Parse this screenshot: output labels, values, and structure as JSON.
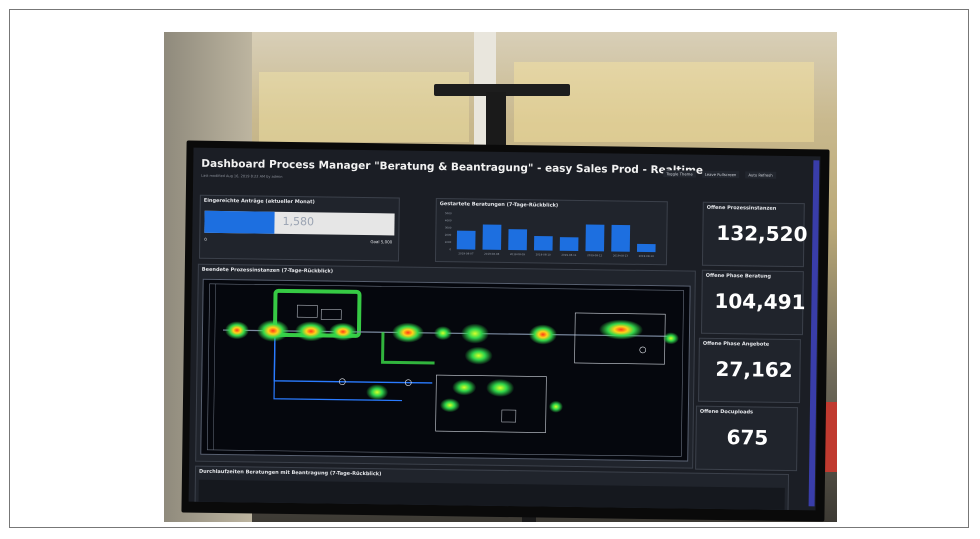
{
  "dashboard": {
    "title": "Dashboard Process Manager \"Beratung & Beantragung\" - easy Sales Prod - Realtime",
    "subtitle": "Last modified Aug 16, 2019 8:22 AM by admin",
    "controls": {
      "toggle_theme": "Toggle Theme",
      "leave_fullscreen": "Leave Fullscreen",
      "auto_refresh": "Auto Refresh"
    }
  },
  "eingereichte": {
    "title": "Eingereichte Anträge (aktueller Monat)",
    "value": "1,580",
    "min": "0",
    "goal": "Goal 5,000",
    "fill_fraction": 0.37
  },
  "gestartete": {
    "title": "Gestartete Beratungen (7-Tage-Rückblick)"
  },
  "stats": {
    "offene_prozess": {
      "label": "Offene Prozessinstanzen",
      "value": "132,520"
    },
    "offene_beratung": {
      "label": "Offene Phase Beratung",
      "value": "104,491"
    },
    "offene_angebote": {
      "label": "Offene Phase Angebote",
      "value": "27,162"
    },
    "offene_docuploads": {
      "label": "Offene Docuploads",
      "value": "675"
    }
  },
  "beendete": {
    "title": "Beendete Prozessinstanzen (7-Tage-Rückblick)"
  },
  "durchlauf": {
    "title": "Durchlaufzeiten Beratungen mit Beantragung (7-Tage-Rückblick)"
  },
  "chart_data": {
    "type": "bar",
    "title": "Gestartete Beratungen (7-Tage-Rückblick)",
    "categories": [
      "2019-08-07",
      "2019-08-08",
      "2019-08-09",
      "2019-08-10",
      "2019-08-11",
      "2019-08-12",
      "2019-08-13",
      "2019-08-14"
    ],
    "values": [
      2600,
      3500,
      2900,
      2000,
      1900,
      3700,
      3700,
      1100
    ],
    "ylim": [
      0,
      5000
    ],
    "yticks": [
      "0",
      "1000",
      "2000",
      "3000",
      "4000",
      "5000"
    ],
    "bar_color": "#1d6fe0"
  },
  "colors": {
    "screen_bg": "#1b1e25",
    "panel_bg": "#20242c",
    "accent_blue": "#1d6fe0",
    "heat_green": "#22d04a",
    "heat_red": "#e8321c"
  }
}
